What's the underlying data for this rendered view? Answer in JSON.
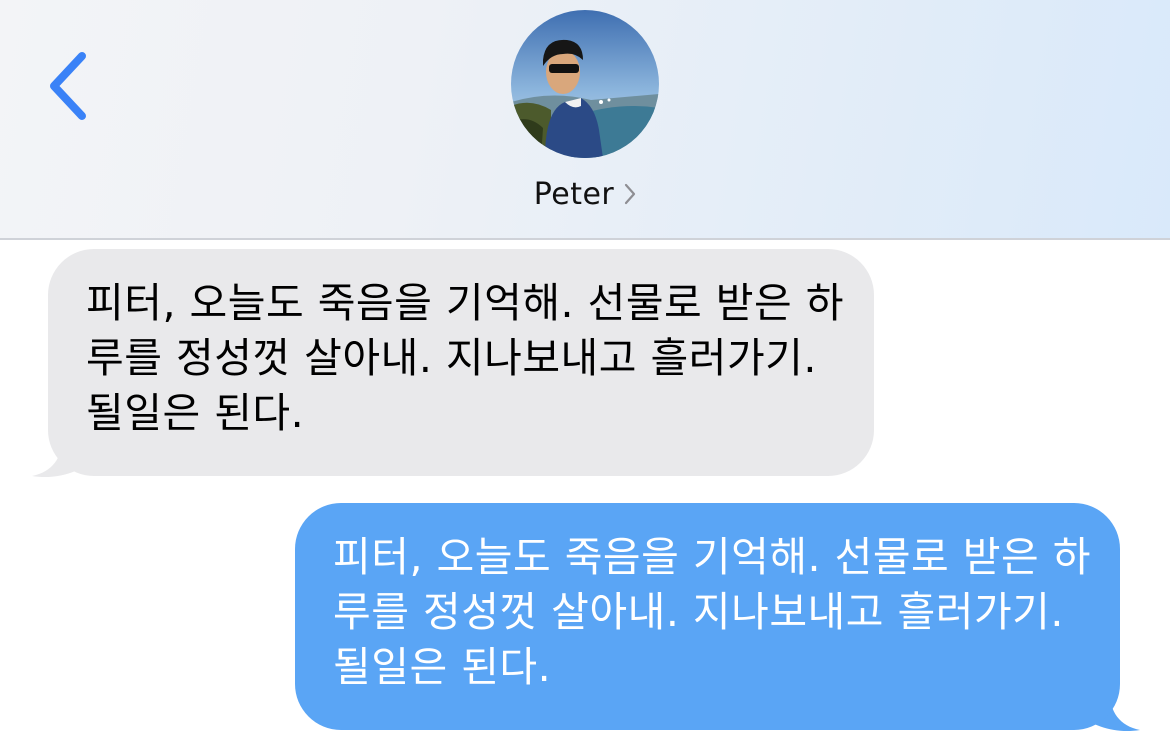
{
  "header": {
    "back_icon": "chevron-left-icon",
    "contact_name": "Peter",
    "contact_chevron_icon": "chevron-right-icon",
    "accent_color": "#3a82f7"
  },
  "messages": [
    {
      "direction": "received",
      "text": "피터, 오늘도 죽음을 기억해. 선물로 받은 하루를 정성껏 살아내. 지나보내고 흘러가기. 될일은 된다.",
      "bubble_color": "#e9e9eb"
    },
    {
      "direction": "sent",
      "text": "피터, 오늘도 죽음을 기억해. 선물로 받은 하루를 정성껏 살아내. 지나보내고 흘러가기. 될일은 된다.",
      "bubble_color": "#5aa5f5"
    }
  ]
}
